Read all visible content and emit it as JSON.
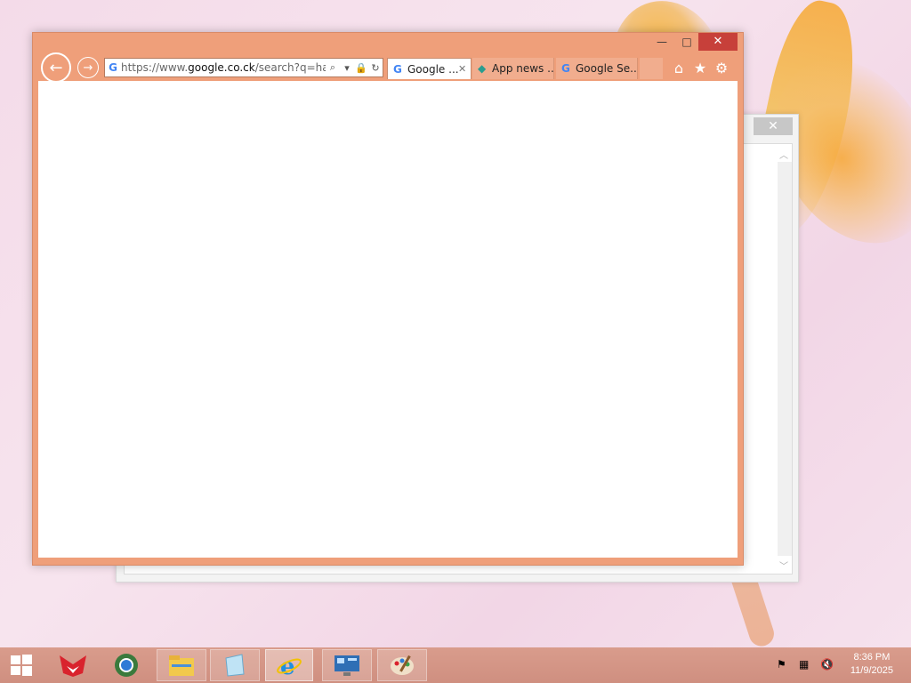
{
  "browser": {
    "address_url_prefix": "https://www.",
    "address_url_domain": "google.co.ck",
    "address_url_rest": "/search?q=half-",
    "tabs": [
      {
        "label": "Google ...",
        "icon": "google-icon",
        "active": true
      },
      {
        "label": "App news ...",
        "icon": "app-news-icon",
        "active": false
      },
      {
        "label": "Google Se...",
        "icon": "google-icon",
        "active": false
      }
    ],
    "caption": {
      "minimize": "—",
      "maximize": "□",
      "close": "✕"
    },
    "tools": {
      "home": "⌂",
      "favorites": "★",
      "settings": "⚙"
    }
  },
  "background_window": {
    "close": "✕"
  },
  "taskbar": {
    "items": [
      "start-icon",
      "app-fox-icon",
      "chrome-icon",
      "file-explorer-icon",
      "notepad-icon",
      "internet-explorer-icon",
      "control-panel-icon",
      "paint-icon"
    ],
    "clock_time": "8:36 PM",
    "clock_date": "11/9/2025"
  },
  "colors": {
    "accent": "#ef9f7a",
    "close_red": "#c7403a",
    "taskbar": "#d39585"
  }
}
